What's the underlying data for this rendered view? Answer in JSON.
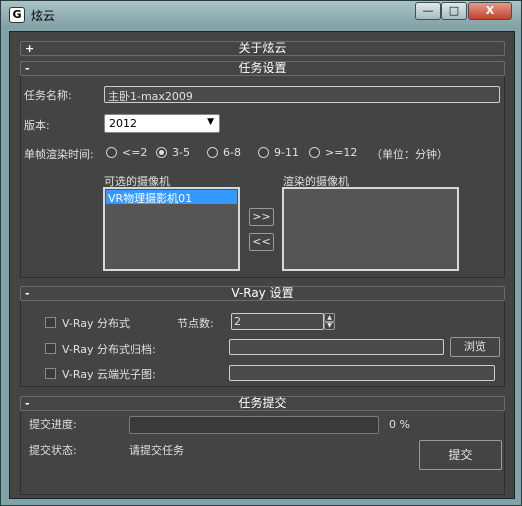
{
  "window": {
    "title": "炫云",
    "app_icon": "G",
    "colors": {
      "title_bg": "#8fb0b4",
      "panel_bg": "#444444",
      "selection": "#3399ff",
      "close_btn": "#c2412a"
    }
  },
  "controls": {
    "minimize": "—",
    "maximize": "□",
    "close": "X"
  },
  "rollouts": {
    "about": {
      "sign": "+",
      "title": "关于炫云"
    },
    "task": {
      "sign": "-",
      "title": "任务设置",
      "task_name_label": "任务名称:",
      "task_name_value": "主卧1-max2009",
      "version_label": "版本:",
      "version_value": "2012",
      "frame_time_label": "单帧渲染时间:",
      "frame_options": [
        "<=2",
        "3-5",
        "6-8",
        "9-11",
        ">=12"
      ],
      "frame_selected": "3-5",
      "unit_note": "（单位：分钟）",
      "available_cameras_label": "可选的摄像机",
      "available_cameras": [
        "VR物理摄影机01"
      ],
      "render_cameras_label": "渲染的摄像机",
      "move_right_label": ">>",
      "move_left_label": "<<"
    },
    "vray": {
      "sign": "-",
      "title": "V-Ray 设置",
      "distributed_label": "V-Ray 分布式",
      "nodes_label": "节点数:",
      "nodes_value": "2",
      "archive_label": "V-Ray 分布式归档:",
      "browse_label": "浏览",
      "cloud_photon_label": "V-Ray 云端光子图:"
    },
    "submit": {
      "sign": "-",
      "title": "任务提交",
      "progress_label": "提交进度:",
      "progress_value": 0,
      "progress_text": "0 %",
      "status_label": "提交状态:",
      "status_value": "请提交任务",
      "submit_label": "提交"
    }
  }
}
